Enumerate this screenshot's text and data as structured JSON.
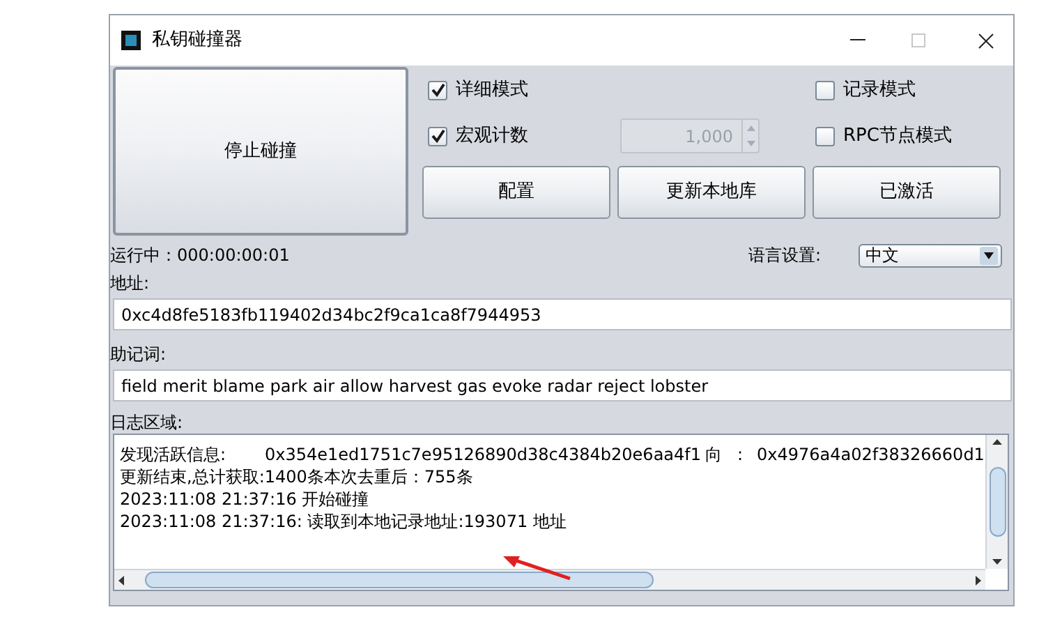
{
  "window": {
    "title": "私钥碰撞器"
  },
  "stop_button": {
    "label": "停止碰撞"
  },
  "options": [
    {
      "label": "详细模式",
      "checked": true
    },
    {
      "label": "宏观计数",
      "checked": true
    },
    {
      "label": "记录模式",
      "checked": false
    },
    {
      "label": "RPC节点模式",
      "checked": false
    }
  ],
  "counter": {
    "value": "1,000",
    "disabled": true
  },
  "buttons": [
    "配置",
    "更新本地库",
    "已激活"
  ],
  "status": "运行中：000:00:00:01",
  "language": {
    "label": "语言设置:",
    "value": "中文"
  },
  "address": {
    "label": "地址:",
    "value": "0xc4d8fe5183fb119402d34bc2f9ca1ca8f7944953"
  },
  "mnemonic": {
    "label": "助记词:",
    "value": "field merit blame park air allow harvest gas evoke radar reject lobster"
  },
  "log": {
    "label": "日志区域:",
    "lines": [
      {
        "kind": "columns",
        "cells": [
          "发现活跃信息:",
          "0x354e1ed1751c7e95126890d38c4384b20e6aa4f1",
          "向",
          ":",
          "0x4976a4a02f38326660d1"
        ]
      },
      {
        "kind": "text",
        "text": "更新结束,总计获取:1400条本次去重后：755条"
      },
      {
        "kind": "text",
        "text": "2023:11:08 21:37:16 开始碰撞"
      },
      {
        "kind": "text",
        "text": "2023:11:08 21:37:16: 读取到本地记录地址:193071 地址"
      }
    ]
  }
}
